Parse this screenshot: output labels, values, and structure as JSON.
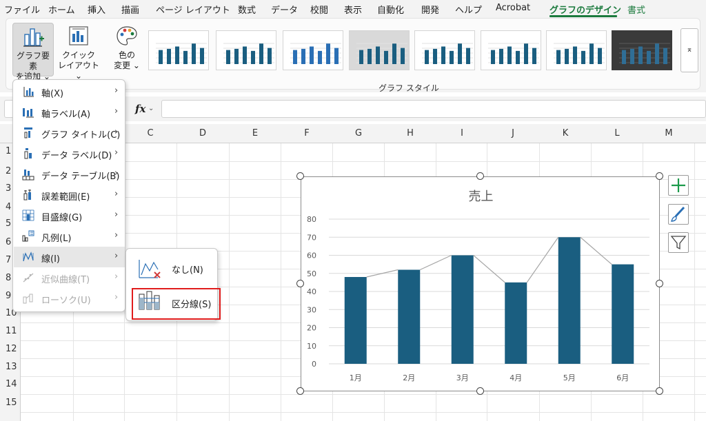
{
  "menu_tabs": [
    {
      "label": "ファイル"
    },
    {
      "label": "ホーム"
    },
    {
      "label": "挿入"
    },
    {
      "label": "描画"
    },
    {
      "label": "ページ レイアウト"
    },
    {
      "label": "数式"
    },
    {
      "label": "データ"
    },
    {
      "label": "校閲"
    },
    {
      "label": "表示"
    },
    {
      "label": "自動化"
    },
    {
      "label": "開発"
    },
    {
      "label": "ヘルプ"
    },
    {
      "label": "Acrobat"
    },
    {
      "label": "グラフのデザイン",
      "active": true
    },
    {
      "label": "書式"
    }
  ],
  "ribbon": {
    "add_element": {
      "line1": "グラフ要素",
      "line2": "を追加 ⌄"
    },
    "quick_layout": {
      "line1": "クイック",
      "line2": "レイアウト ⌄"
    },
    "change_color": {
      "line1": "色の",
      "line2": "変更 ⌄"
    },
    "style_group_label": "グラフ スタイル",
    "gallery_more": "⌅"
  },
  "formula_bar": {
    "fx": "fx",
    "chevron": "⌄",
    "value": ""
  },
  "columns": [
    "C",
    "D",
    "E",
    "F",
    "G",
    "H",
    "I",
    "J",
    "K",
    "L",
    "M"
  ],
  "rows": [
    "1",
    "2",
    "3",
    "4",
    "5",
    "6",
    "7",
    "8",
    "9",
    "10",
    "11",
    "12",
    "13",
    "14",
    "15"
  ],
  "chart_data": {
    "type": "bar",
    "title": "売上",
    "categories": [
      "1月",
      "2月",
      "3月",
      "4月",
      "5月",
      "6月"
    ],
    "values": [
      48,
      52,
      60,
      45,
      70,
      55
    ],
    "ylim": [
      0,
      80
    ],
    "yticks": [
      "0",
      "10",
      "20",
      "30",
      "40",
      "50",
      "60",
      "70",
      "80"
    ],
    "bar_color": "#1a5e80",
    "line_color": "#a6a6a6",
    "series_lines": true,
    "grid": true
  },
  "dropdown_menu": {
    "items": [
      {
        "label": "軸(X)",
        "icon": "axes-icon",
        "disabled": false
      },
      {
        "label": "軸ラベル(A)",
        "icon": "axis-labels-icon",
        "disabled": false
      },
      {
        "label": "グラフ タイトル(C)",
        "icon": "chart-title-icon",
        "disabled": false
      },
      {
        "label": "データ ラベル(D)",
        "icon": "data-labels-icon",
        "disabled": false
      },
      {
        "label": "データ テーブル(B)",
        "icon": "data-table-icon",
        "disabled": false
      },
      {
        "label": "誤差範囲(E)",
        "icon": "error-bars-icon",
        "disabled": false
      },
      {
        "label": "目盛線(G)",
        "icon": "gridlines-icon",
        "disabled": false
      },
      {
        "label": "凡例(L)",
        "icon": "legend-icon",
        "disabled": false
      },
      {
        "label": "線(I)",
        "icon": "lines-icon",
        "disabled": false,
        "hover": true
      },
      {
        "label": "近似曲線(T)",
        "icon": "trendline-icon",
        "disabled": true
      },
      {
        "label": "ローソク(U)",
        "icon": "up-down-bars-icon",
        "disabled": true
      }
    ],
    "arrow": "›"
  },
  "submenu": {
    "items": [
      {
        "label": "なし(N)",
        "icon": "no-lines-icon"
      },
      {
        "label": "区分線(S)",
        "icon": "series-lines-icon",
        "highlighted": true
      }
    ]
  },
  "colors": {
    "accent": "#1b7a3d",
    "highlight": "#e01b1b"
  }
}
